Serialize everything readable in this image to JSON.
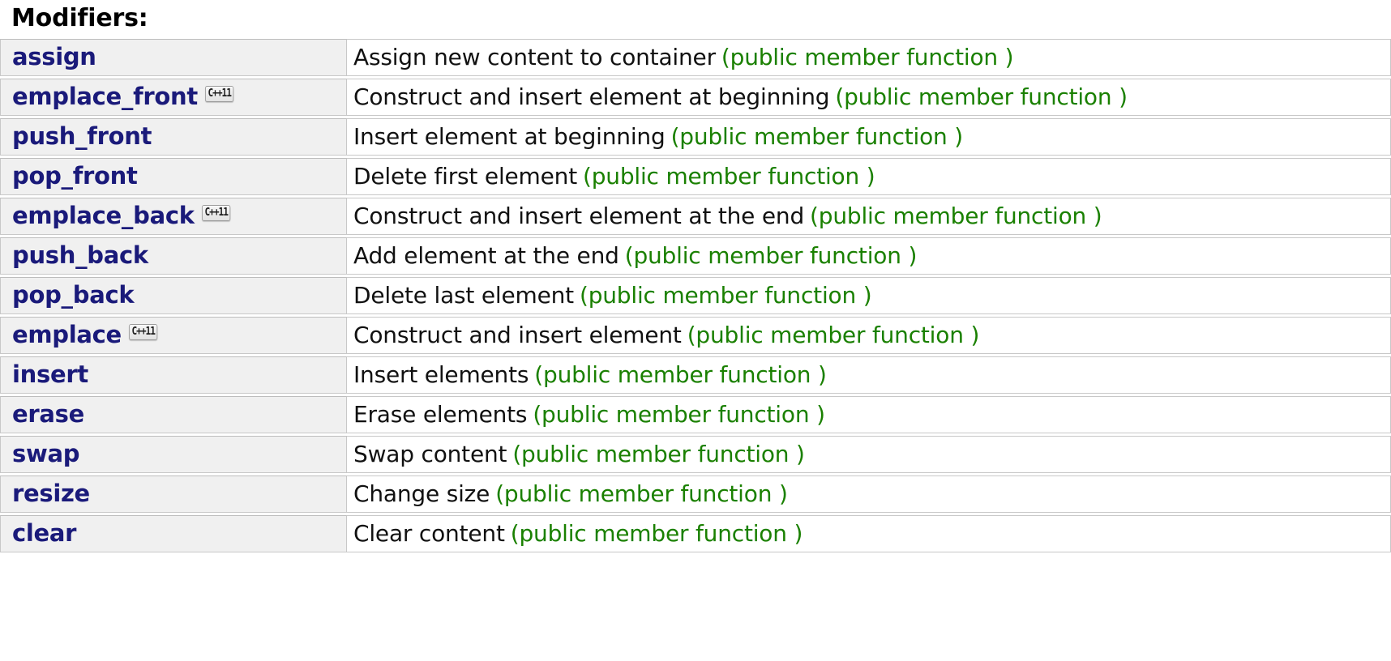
{
  "section": {
    "title": "Modifiers:"
  },
  "kind_label": "(public member function )",
  "badge_label": "C++11",
  "colors": {
    "link": "#1a1a7a",
    "kind": "#1a8000",
    "description": "#111111",
    "name_cell_bg": "#f0f0f0",
    "desc_cell_bg": "#ffffff",
    "border": "#c8c8c8"
  },
  "rows": [
    {
      "name": "assign",
      "badge": null,
      "description": "Assign new content to container",
      "kind": "(public member function )"
    },
    {
      "name": "emplace_front",
      "badge": "C++11",
      "description": "Construct and insert element at beginning",
      "kind": "(public member function )"
    },
    {
      "name": "push_front",
      "badge": null,
      "description": "Insert element at beginning",
      "kind": "(public member function )"
    },
    {
      "name": "pop_front",
      "badge": null,
      "description": "Delete first element",
      "kind": "(public member function )"
    },
    {
      "name": "emplace_back",
      "badge": "C++11",
      "description": "Construct and insert element at the end",
      "kind": "(public member function )"
    },
    {
      "name": "push_back",
      "badge": null,
      "description": "Add element at the end",
      "kind": "(public member function )"
    },
    {
      "name": "pop_back",
      "badge": null,
      "description": "Delete last element",
      "kind": "(public member function )"
    },
    {
      "name": "emplace",
      "badge": "C++11",
      "description": "Construct and insert element",
      "kind": "(public member function )"
    },
    {
      "name": "insert",
      "badge": null,
      "description": "Insert elements",
      "kind": "(public member function )"
    },
    {
      "name": "erase",
      "badge": null,
      "description": "Erase elements",
      "kind": "(public member function )"
    },
    {
      "name": "swap",
      "badge": null,
      "description": "Swap content",
      "kind": "(public member function )"
    },
    {
      "name": "resize",
      "badge": null,
      "description": "Change size",
      "kind": "(public member function )"
    },
    {
      "name": "clear",
      "badge": null,
      "description": "Clear content",
      "kind": "(public member function )"
    }
  ]
}
